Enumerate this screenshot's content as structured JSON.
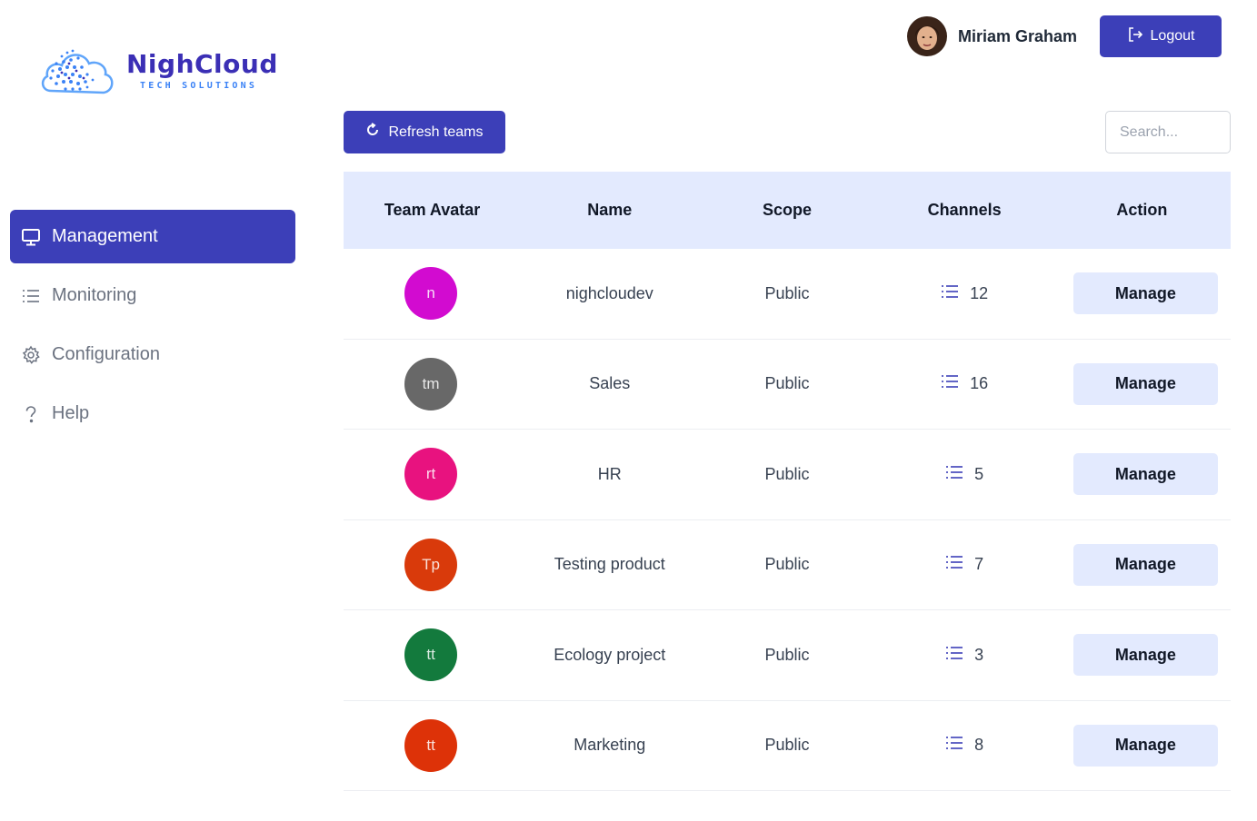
{
  "brand": {
    "name": "NighCloud",
    "tagline": "TECH SOLUTIONS",
    "color": "#3b2fb5"
  },
  "header": {
    "user_name": "Miriam Graham",
    "logout_label": "Logout"
  },
  "sidebar": {
    "items": [
      {
        "label": "Management",
        "icon": "monitor-icon",
        "active": true
      },
      {
        "label": "Monitoring",
        "icon": "list-icon",
        "active": false
      },
      {
        "label": "Configuration",
        "icon": "gear-icon",
        "active": false
      },
      {
        "label": "Help",
        "icon": "question-icon",
        "active": false
      }
    ]
  },
  "toolbar": {
    "refresh_label": "Refresh teams",
    "search_placeholder": "Search..."
  },
  "table": {
    "columns": [
      "Team Avatar",
      "Name",
      "Scope",
      "Channels",
      "Action"
    ],
    "rows": [
      {
        "initials": "n",
        "color": "#d20bd0",
        "name": "nighcloudev",
        "scope": "Public",
        "channels": "12",
        "action": "Manage"
      },
      {
        "initials": "tm",
        "color": "#686868",
        "name": "Sales",
        "scope": "Public",
        "channels": "16",
        "action": "Manage"
      },
      {
        "initials": "rt",
        "color": "#e8127f",
        "name": "HR",
        "scope": "Public",
        "channels": "5",
        "action": "Manage"
      },
      {
        "initials": "Tp",
        "color": "#d93a0b",
        "name": "Testing product",
        "scope": "Public",
        "channels": "7",
        "action": "Manage"
      },
      {
        "initials": "tt",
        "color": "#137a3d",
        "name": "Ecology project",
        "scope": "Public",
        "channels": "3",
        "action": "Manage"
      },
      {
        "initials": "tt",
        "color": "#dd3208",
        "name": "Marketing",
        "scope": "Public",
        "channels": "8",
        "action": "Manage"
      }
    ]
  },
  "colors": {
    "accent": "#3c3fb8",
    "header_bg": "#e3eafe"
  }
}
